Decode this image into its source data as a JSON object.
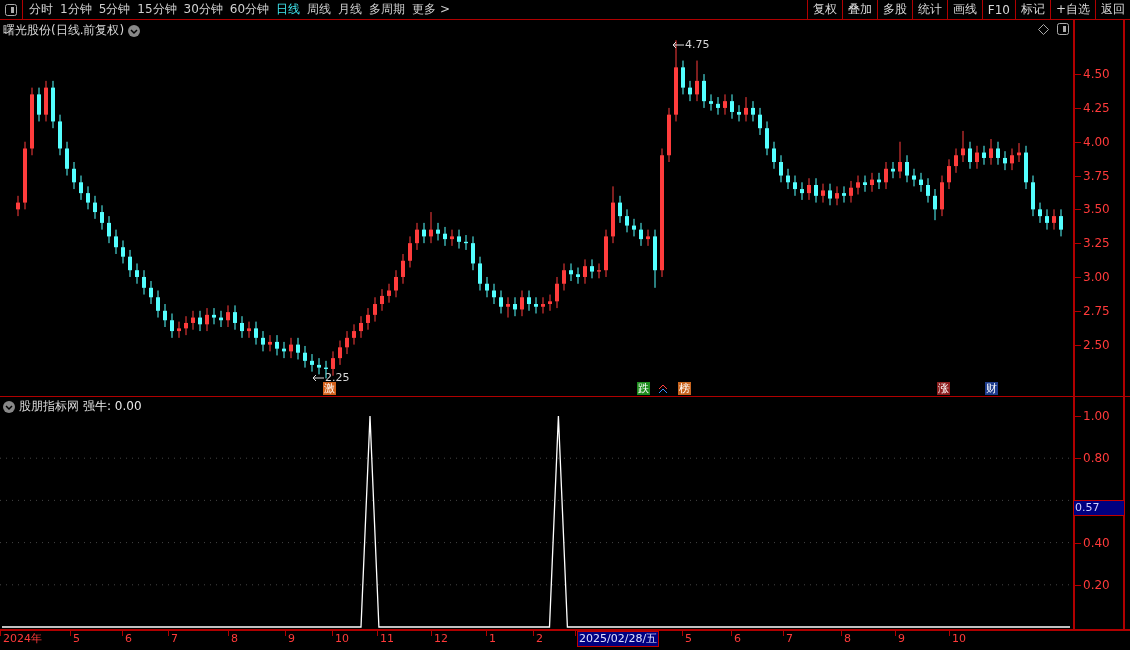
{
  "toolbar": {
    "periods": [
      {
        "label": "分时",
        "selected": false
      },
      {
        "label": "1分钟",
        "selected": false
      },
      {
        "label": "5分钟",
        "selected": false
      },
      {
        "label": "15分钟",
        "selected": false
      },
      {
        "label": "30分钟",
        "selected": false
      },
      {
        "label": "60分钟",
        "selected": false
      },
      {
        "label": "日线",
        "selected": true
      },
      {
        "label": "周线",
        "selected": false
      },
      {
        "label": "月线",
        "selected": false
      },
      {
        "label": "多周期",
        "selected": false
      },
      {
        "label": "更多 >",
        "selected": false
      }
    ],
    "actions": [
      "复权",
      "叠加",
      "多股",
      "统计",
      "画线",
      "F10",
      "标记",
      "+自选",
      "返回"
    ]
  },
  "main_chart": {
    "title": "曙光股份(日线.前复权)",
    "high_label": "4.75",
    "low_label": "2.25",
    "markers": [
      {
        "text": "激",
        "color": "#d2601a"
      },
      {
        "text": "跌",
        "color": "#1e8c1e"
      },
      {
        "text": "榜",
        "color": "#c8641e"
      },
      {
        "text": "涨",
        "color": "#8c1e1e"
      },
      {
        "text": "财",
        "color": "#1e3c8c"
      }
    ],
    "chart_data": {
      "type": "candlestick",
      "ylim": [
        2.12,
        4.9
      ],
      "categories": [
        null,
        null,
        null,
        null,
        null,
        null,
        null,
        null,
        null,
        null,
        null,
        null,
        null,
        null,
        null,
        null,
        null,
        null,
        null,
        null,
        null,
        null,
        null,
        null,
        null,
        null,
        null,
        null,
        null,
        null,
        null,
        null,
        null,
        null,
        null,
        null,
        null,
        null,
        null,
        null,
        null,
        null,
        null,
        null,
        null,
        null,
        null,
        null,
        null,
        null,
        null,
        null,
        null,
        null,
        null,
        null,
        null,
        null,
        null,
        null,
        null,
        null,
        null,
        null,
        null,
        null,
        null,
        null,
        null,
        null,
        null,
        null,
        null,
        null,
        null,
        null,
        null,
        null,
        null,
        null,
        null,
        null,
        null,
        null,
        null,
        null,
        null,
        null,
        null,
        null,
        null,
        null,
        null,
        null,
        null,
        null,
        null,
        null,
        null,
        null,
        null,
        null,
        null,
        null,
        null,
        null,
        null,
        null,
        null,
        null,
        null,
        null,
        null,
        null,
        null,
        null,
        null,
        null,
        null,
        null,
        null,
        null,
        null,
        null,
        null,
        null,
        null,
        null,
        null,
        null,
        null,
        null,
        null,
        null,
        null,
        null,
        null,
        null,
        null,
        null,
        null,
        null,
        null,
        null,
        null,
        null,
        null,
        null,
        null,
        null
      ],
      "yticks": [
        {
          "value": 4.5,
          "label": "4.50"
        },
        {
          "value": 4.25,
          "label": "4.25"
        },
        {
          "value": 4.0,
          "label": "4.00"
        },
        {
          "value": 3.75,
          "label": "3.75"
        },
        {
          "value": 3.5,
          "label": "3.50"
        },
        {
          "value": 3.25,
          "label": "3.25"
        },
        {
          "value": 3.0,
          "label": "3.00"
        },
        {
          "value": 2.75,
          "label": "2.75"
        },
        {
          "value": 2.5,
          "label": "2.50"
        }
      ],
      "ohlc": [
        [
          3.5,
          3.6,
          3.45,
          3.55
        ],
        [
          3.55,
          4.0,
          3.5,
          3.95
        ],
        [
          3.95,
          4.4,
          3.9,
          4.35
        ],
        [
          4.35,
          4.4,
          4.15,
          4.2
        ],
        [
          4.2,
          4.45,
          4.15,
          4.4
        ],
        [
          4.4,
          4.45,
          4.1,
          4.15
        ],
        [
          4.15,
          4.2,
          3.9,
          3.95
        ],
        [
          3.95,
          4.0,
          3.75,
          3.8
        ],
        [
          3.8,
          3.85,
          3.65,
          3.7
        ],
        [
          3.7,
          3.75,
          3.57,
          3.62
        ],
        [
          3.62,
          3.67,
          3.5,
          3.55
        ],
        [
          3.55,
          3.6,
          3.43,
          3.48
        ],
        [
          3.48,
          3.53,
          3.35,
          3.4
        ],
        [
          3.4,
          3.45,
          3.25,
          3.3
        ],
        [
          3.3,
          3.35,
          3.17,
          3.22
        ],
        [
          3.22,
          3.27,
          3.1,
          3.15
        ],
        [
          3.15,
          3.2,
          3.0,
          3.05
        ],
        [
          3.05,
          3.1,
          2.95,
          3.0
        ],
        [
          3.0,
          3.05,
          2.87,
          2.92
        ],
        [
          2.92,
          2.97,
          2.8,
          2.85
        ],
        [
          2.85,
          2.9,
          2.7,
          2.75
        ],
        [
          2.75,
          2.8,
          2.63,
          2.68
        ],
        [
          2.68,
          2.73,
          2.55,
          2.6
        ],
        [
          2.6,
          2.67,
          2.55,
          2.62
        ],
        [
          2.62,
          2.71,
          2.57,
          2.66
        ],
        [
          2.66,
          2.75,
          2.61,
          2.7
        ],
        [
          2.7,
          2.75,
          2.6,
          2.65
        ],
        [
          2.65,
          2.77,
          2.6,
          2.72
        ],
        [
          2.72,
          2.77,
          2.65,
          2.7
        ],
        [
          2.7,
          2.75,
          2.63,
          2.68
        ],
        [
          2.68,
          2.79,
          2.63,
          2.74
        ],
        [
          2.74,
          2.79,
          2.61,
          2.66
        ],
        [
          2.66,
          2.71,
          2.55,
          2.6
        ],
        [
          2.6,
          2.67,
          2.55,
          2.62
        ],
        [
          2.62,
          2.67,
          2.5,
          2.55
        ],
        [
          2.55,
          2.6,
          2.45,
          2.5
        ],
        [
          2.5,
          2.57,
          2.45,
          2.52
        ],
        [
          2.52,
          2.57,
          2.42,
          2.47
        ],
        [
          2.47,
          2.52,
          2.4,
          2.45
        ],
        [
          2.45,
          2.55,
          2.4,
          2.5
        ],
        [
          2.5,
          2.55,
          2.39,
          2.44
        ],
        [
          2.44,
          2.49,
          2.33,
          2.38
        ],
        [
          2.38,
          2.43,
          2.3,
          2.35
        ],
        [
          2.35,
          2.4,
          2.28,
          2.33
        ],
        [
          2.33,
          2.38,
          2.25,
          2.32
        ],
        [
          2.32,
          2.45,
          2.27,
          2.4
        ],
        [
          2.4,
          2.53,
          2.35,
          2.48
        ],
        [
          2.48,
          2.6,
          2.43,
          2.55
        ],
        [
          2.55,
          2.65,
          2.5,
          2.6
        ],
        [
          2.6,
          2.71,
          2.55,
          2.66
        ],
        [
          2.66,
          2.77,
          2.61,
          2.72
        ],
        [
          2.72,
          2.85,
          2.67,
          2.8
        ],
        [
          2.8,
          2.91,
          2.75,
          2.86
        ],
        [
          2.86,
          2.95,
          2.81,
          2.9
        ],
        [
          2.9,
          3.05,
          2.85,
          3.0
        ],
        [
          3.0,
          3.17,
          2.95,
          3.12
        ],
        [
          3.12,
          3.3,
          3.07,
          3.25
        ],
        [
          3.25,
          3.4,
          3.2,
          3.35
        ],
        [
          3.35,
          3.4,
          3.25,
          3.3
        ],
        [
          3.3,
          3.48,
          3.25,
          3.35
        ],
        [
          3.35,
          3.4,
          3.27,
          3.32
        ],
        [
          3.32,
          3.37,
          3.23,
          3.28
        ],
        [
          3.28,
          3.35,
          3.23,
          3.3
        ],
        [
          3.3,
          3.35,
          3.21,
          3.26
        ],
        [
          3.26,
          3.31,
          3.2,
          3.25
        ],
        [
          3.25,
          3.3,
          3.05,
          3.1
        ],
        [
          3.1,
          3.15,
          2.9,
          2.95
        ],
        [
          2.95,
          3.0,
          2.85,
          2.9
        ],
        [
          2.9,
          2.95,
          2.8,
          2.85
        ],
        [
          2.85,
          2.9,
          2.73,
          2.78
        ],
        [
          2.78,
          2.85,
          2.7,
          2.8
        ],
        [
          2.8,
          2.85,
          2.71,
          2.76
        ],
        [
          2.76,
          2.9,
          2.71,
          2.85
        ],
        [
          2.85,
          2.9,
          2.75,
          2.8
        ],
        [
          2.8,
          2.85,
          2.73,
          2.78
        ],
        [
          2.78,
          2.85,
          2.73,
          2.8
        ],
        [
          2.8,
          2.87,
          2.75,
          2.82
        ],
        [
          2.82,
          3.0,
          2.77,
          2.95
        ],
        [
          2.95,
          3.1,
          2.9,
          3.05
        ],
        [
          3.05,
          3.1,
          2.97,
          3.02
        ],
        [
          3.02,
          3.07,
          2.95,
          3.0
        ],
        [
          3.0,
          3.13,
          2.95,
          3.08
        ],
        [
          3.08,
          3.13,
          2.99,
          3.04
        ],
        [
          3.04,
          3.1,
          2.99,
          3.05
        ],
        [
          3.05,
          3.35,
          3.0,
          3.3
        ],
        [
          3.3,
          3.67,
          3.25,
          3.55
        ],
        [
          3.55,
          3.6,
          3.4,
          3.45
        ],
        [
          3.45,
          3.5,
          3.33,
          3.38
        ],
        [
          3.38,
          3.43,
          3.3,
          3.35
        ],
        [
          3.35,
          3.4,
          3.23,
          3.28
        ],
        [
          3.28,
          3.35,
          3.23,
          3.3
        ],
        [
          3.3,
          3.35,
          2.92,
          3.05
        ],
        [
          3.05,
          3.95,
          3.0,
          3.9
        ],
        [
          3.9,
          4.25,
          3.85,
          4.2
        ],
        [
          4.2,
          4.75,
          4.15,
          4.55
        ],
        [
          4.55,
          4.6,
          4.35,
          4.4
        ],
        [
          4.4,
          4.45,
          4.3,
          4.35
        ],
        [
          4.35,
          4.6,
          4.3,
          4.45
        ],
        [
          4.45,
          4.5,
          4.25,
          4.3
        ],
        [
          4.3,
          4.35,
          4.23,
          4.28
        ],
        [
          4.28,
          4.33,
          4.2,
          4.25
        ],
        [
          4.25,
          4.35,
          4.2,
          4.3
        ],
        [
          4.3,
          4.35,
          4.17,
          4.22
        ],
        [
          4.22,
          4.27,
          4.15,
          4.2
        ],
        [
          4.2,
          4.33,
          4.15,
          4.25
        ],
        [
          4.25,
          4.3,
          4.15,
          4.2
        ],
        [
          4.2,
          4.25,
          4.05,
          4.1
        ],
        [
          4.1,
          4.15,
          3.9,
          3.95
        ],
        [
          3.95,
          4.0,
          3.8,
          3.85
        ],
        [
          3.85,
          3.9,
          3.7,
          3.75
        ],
        [
          3.75,
          3.8,
          3.65,
          3.7
        ],
        [
          3.7,
          3.75,
          3.6,
          3.65
        ],
        [
          3.65,
          3.7,
          3.57,
          3.62
        ],
        [
          3.62,
          3.73,
          3.57,
          3.68
        ],
        [
          3.68,
          3.73,
          3.55,
          3.6
        ],
        [
          3.6,
          3.69,
          3.55,
          3.64
        ],
        [
          3.64,
          3.69,
          3.53,
          3.58
        ],
        [
          3.58,
          3.67,
          3.53,
          3.62
        ],
        [
          3.62,
          3.67,
          3.55,
          3.6
        ],
        [
          3.6,
          3.71,
          3.55,
          3.66
        ],
        [
          3.66,
          3.75,
          3.61,
          3.7
        ],
        [
          3.7,
          3.75,
          3.63,
          3.68
        ],
        [
          3.68,
          3.77,
          3.63,
          3.72
        ],
        [
          3.72,
          3.77,
          3.65,
          3.7
        ],
        [
          3.7,
          3.85,
          3.65,
          3.8
        ],
        [
          3.8,
          3.85,
          3.73,
          3.78
        ],
        [
          3.78,
          4.0,
          3.73,
          3.85
        ],
        [
          3.85,
          3.9,
          3.7,
          3.75
        ],
        [
          3.75,
          3.8,
          3.67,
          3.72
        ],
        [
          3.72,
          3.77,
          3.63,
          3.68
        ],
        [
          3.68,
          3.73,
          3.55,
          3.6
        ],
        [
          3.6,
          3.65,
          3.42,
          3.5
        ],
        [
          3.5,
          3.75,
          3.45,
          3.7
        ],
        [
          3.7,
          3.87,
          3.65,
          3.82
        ],
        [
          3.82,
          3.95,
          3.77,
          3.9
        ],
        [
          3.9,
          4.08,
          3.85,
          3.95
        ],
        [
          3.95,
          4.0,
          3.8,
          3.85
        ],
        [
          3.85,
          3.97,
          3.8,
          3.92
        ],
        [
          3.92,
          3.97,
          3.83,
          3.88
        ],
        [
          3.88,
          4.02,
          3.83,
          3.95
        ],
        [
          3.95,
          4.0,
          3.83,
          3.88
        ],
        [
          3.88,
          3.93,
          3.79,
          3.84
        ],
        [
          3.84,
          3.95,
          3.79,
          3.9
        ],
        [
          3.9,
          3.99,
          3.85,
          3.92
        ],
        [
          3.92,
          3.97,
          3.65,
          3.7
        ],
        [
          3.7,
          3.75,
          3.45,
          3.5
        ],
        [
          3.5,
          3.55,
          3.4,
          3.45
        ],
        [
          3.45,
          3.5,
          3.35,
          3.4
        ],
        [
          3.4,
          3.5,
          3.35,
          3.45
        ],
        [
          3.45,
          3.5,
          3.3,
          3.35
        ]
      ]
    }
  },
  "indicator": {
    "title": "股朋指标网",
    "value_label": "强牛: 0.00",
    "cursor_value": "0.57",
    "chart_data": {
      "type": "line",
      "grid": true,
      "ylim": [
        0,
        1.09
      ],
      "categories": [
        null,
        null,
        null,
        null,
        null,
        null,
        null,
        null,
        null,
        null,
        null,
        null,
        null,
        null,
        null,
        null,
        null,
        null,
        null,
        null,
        null,
        null,
        null,
        null,
        null,
        null,
        null,
        null,
        null,
        null,
        null,
        null,
        null,
        null,
        null,
        null,
        null,
        null,
        null,
        null,
        null,
        null,
        null,
        null,
        null,
        null,
        null,
        null,
        null,
        null,
        null,
        null,
        null,
        null,
        null,
        null,
        null,
        null,
        null,
        null,
        null,
        null,
        null,
        null,
        null,
        null,
        null,
        null,
        null,
        null,
        null,
        null,
        null,
        null,
        null,
        null,
        null,
        null,
        null,
        null,
        null,
        null,
        null,
        null,
        null,
        null,
        null,
        null,
        null,
        null,
        null,
        null,
        null,
        null,
        null,
        null,
        null,
        null,
        null,
        null,
        null,
        null,
        null,
        null,
        null,
        null,
        null,
        null,
        null,
        null,
        null,
        null,
        null,
        null,
        null,
        null,
        null,
        null,
        null,
        null
      ],
      "yticks": [
        {
          "value": 1,
          "label": "1.00"
        },
        {
          "value": 0.8,
          "label": "0.80"
        },
        {
          "value": 0.4,
          "label": "0.40"
        },
        {
          "value": 0.2,
          "label": "0.20"
        }
      ],
      "series": [
        {
          "color": "#ffffff",
          "values": [
            0,
            0,
            0,
            0,
            0,
            0,
            0,
            0,
            0,
            0,
            0,
            0,
            0,
            0,
            0,
            0,
            0,
            0,
            0,
            0,
            0,
            0,
            0,
            0,
            0,
            0,
            0,
            0,
            0,
            0,
            0,
            0,
            0,
            0,
            0,
            0,
            0,
            0,
            0,
            0,
            0,
            1,
            0,
            0,
            0,
            0,
            0,
            0,
            0,
            0,
            0,
            0,
            0,
            0,
            0,
            0,
            0,
            0,
            0,
            0,
            0,
            0,
            1,
            0,
            0,
            0,
            0,
            0,
            0,
            0,
            0,
            0,
            0,
            0,
            0,
            0,
            0,
            0,
            0,
            0,
            0,
            0,
            0,
            0,
            0,
            0,
            0,
            0,
            0,
            0,
            0,
            0,
            0,
            0,
            0,
            0,
            0,
            0,
            0,
            0,
            0,
            0,
            0,
            0,
            0,
            0,
            0,
            0,
            0,
            0,
            0,
            0,
            0,
            0,
            0,
            0,
            0,
            0,
            0,
            0
          ]
        }
      ]
    }
  },
  "date_axis": {
    "labels": [
      {
        "text": "2024年",
        "selected": false
      },
      {
        "text": "5",
        "selected": false
      },
      {
        "text": "6",
        "selected": false
      },
      {
        "text": "7",
        "selected": false
      },
      {
        "text": "8",
        "selected": false
      },
      {
        "text": "9",
        "selected": false
      },
      {
        "text": "10",
        "selected": false
      },
      {
        "text": "11",
        "selected": false
      },
      {
        "text": "12",
        "selected": false
      },
      {
        "text": "1",
        "selected": false
      },
      {
        "text": "2",
        "selected": false
      },
      {
        "text": "2025/02/28/五",
        "selected": true
      },
      {
        "text": "5",
        "selected": false
      },
      {
        "text": "6",
        "selected": false
      },
      {
        "text": "7",
        "selected": false
      },
      {
        "text": "8",
        "selected": false
      },
      {
        "text": "9",
        "selected": false
      },
      {
        "text": "10",
        "selected": false
      }
    ]
  }
}
